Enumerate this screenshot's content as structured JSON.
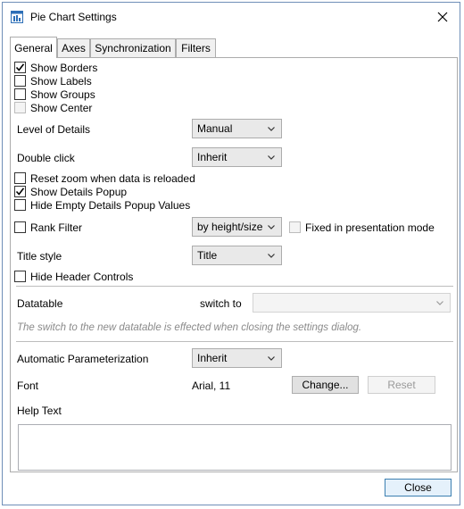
{
  "window": {
    "title": "Pie Chart Settings"
  },
  "tabs": [
    {
      "label": "General",
      "active": true
    },
    {
      "label": "Axes",
      "active": false
    },
    {
      "label": "Synchronization",
      "active": false
    },
    {
      "label": "Filters",
      "active": false
    }
  ],
  "general": {
    "show_borders": {
      "label": "Show Borders",
      "checked": true
    },
    "show_labels": {
      "label": "Show Labels",
      "checked": false
    },
    "show_groups": {
      "label": "Show Groups",
      "checked": false
    },
    "show_center": {
      "label": "Show Center",
      "checked": false,
      "enabled": false
    },
    "level_of_details": {
      "label": "Level of Details",
      "value": "Manual"
    },
    "double_click": {
      "label": "Double click",
      "value": "Inherit"
    },
    "reset_zoom": {
      "label": "Reset zoom when data is reloaded",
      "checked": false
    },
    "show_details_popup": {
      "label": "Show Details Popup",
      "checked": true
    },
    "hide_empty_details": {
      "label": "Hide Empty Details Popup Values",
      "checked": false
    },
    "rank_filter": {
      "label": "Rank Filter",
      "checked": false,
      "value": "by height/size"
    },
    "fixed_presentation": {
      "label": "Fixed in presentation mode",
      "checked": false,
      "enabled": false
    },
    "title_style": {
      "label": "Title style",
      "value": "Title"
    },
    "hide_header_controls": {
      "label": "Hide Header Controls",
      "checked": false
    }
  },
  "datatable": {
    "label": "Datatable",
    "switch_to_label": "switch to",
    "switch_to_value": "",
    "note": "The switch to the new datatable is effected when closing the settings dialog."
  },
  "parameterization": {
    "label": "Automatic Parameterization",
    "value": "Inherit"
  },
  "font": {
    "label": "Font",
    "value": "Arial, 11",
    "change_label": "Change...",
    "reset_label": "Reset"
  },
  "help_text": {
    "label": "Help Text",
    "value": ""
  },
  "footer": {
    "close_label": "Close"
  },
  "colors": {
    "check": "#000000",
    "border": "#6f8fb8",
    "icon_blue": "#2d6fb7"
  }
}
